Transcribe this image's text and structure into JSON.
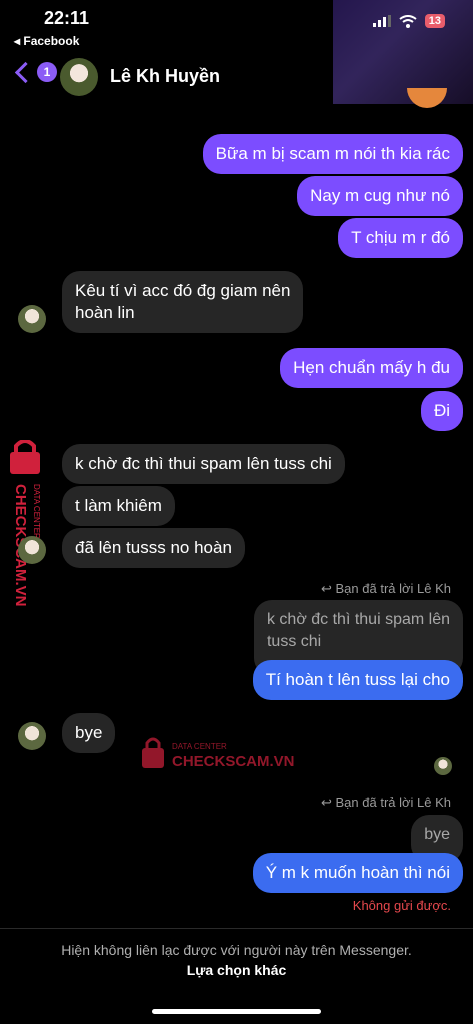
{
  "status": {
    "time": "22:11",
    "back_app": "◂ Facebook",
    "battery": "13"
  },
  "header": {
    "unread_count": "1",
    "contact_name": "Lê Kh Huyền"
  },
  "messages": {
    "m1": "Bữa m bị scam m nói th kia rác",
    "m2": "Nay m cug như nó",
    "m3": "T chịu m r đó",
    "m4_line1": "Kêu tí vì acc đó đg giam nên",
    "m4_line2": "hoàn lin",
    "m5": "Hẹn chuẩn mấy h đu",
    "m6": "Đi",
    "m7": "k chờ đc thì thui spam lên tuss chi",
    "m8": "t làm khiêm",
    "m9": "đã lên tusss no hoàn",
    "reply_note_1": "Bạn đã trả lời Lê Kh",
    "quote1_line1": "k chờ đc thì thui spam lên",
    "quote1_line2": "tuss chi",
    "m10": "Tí hoàn t lên tuss lại cho",
    "m11": "bye",
    "reply_note_2": "Bạn đã trả lời Lê Kh",
    "quote2": "bye",
    "m12": "Ý m k muốn hoàn thì nói",
    "error": "Không gửi được."
  },
  "watermark": {
    "brand": "CHECKSCAM.VN",
    "sub": "DATA CENTER"
  },
  "footer": {
    "notice": "Hiện không liên lạc được với người này trên Messenger.",
    "link": "Lựa chọn khác"
  },
  "colors": {
    "outgoing": "#7c4dff",
    "outgoing_alt": "#3b6cf0",
    "incoming": "#262626",
    "error": "#e5484d",
    "watermark": "#d0213c"
  }
}
